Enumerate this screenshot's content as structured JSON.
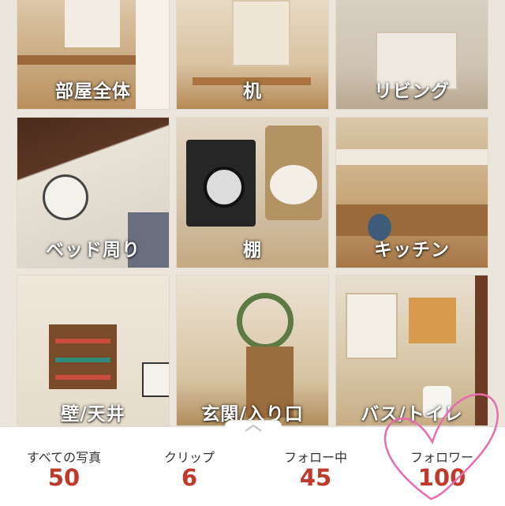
{
  "categories": [
    {
      "label": "部屋全体"
    },
    {
      "label": "机"
    },
    {
      "label": "リビング"
    },
    {
      "label": "ベッド周り"
    },
    {
      "label": "棚"
    },
    {
      "label": "キッチン"
    },
    {
      "label": "壁/天井"
    },
    {
      "label": "玄関/入り口"
    },
    {
      "label": "バス/トイレ"
    }
  ],
  "stats": [
    {
      "name": "すべての写真",
      "value": "50"
    },
    {
      "name": "クリップ",
      "value": "6"
    },
    {
      "name": "フォロー中",
      "value": "45"
    },
    {
      "name": "フォロワー",
      "value": "100"
    }
  ],
  "colors": {
    "stat_number": "#c0392b",
    "heart_annotation": "#e86bb0",
    "background": "#ebe5dc"
  }
}
